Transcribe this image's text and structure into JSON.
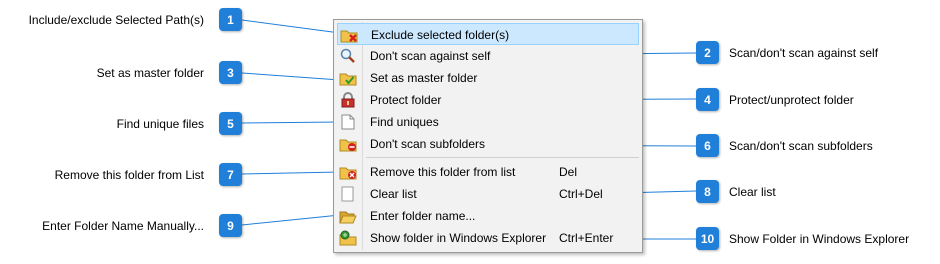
{
  "menu": {
    "items": [
      {
        "label": "Exclude selected folder(s)",
        "shortcut": "",
        "icon": "exclude-folder-icon"
      },
      {
        "label": "Don't scan against self",
        "shortcut": "",
        "icon": "magnifier-icon"
      },
      {
        "label": "Set as master folder",
        "shortcut": "",
        "icon": "master-folder-icon"
      },
      {
        "label": "Protect folder",
        "shortcut": "",
        "icon": "lock-icon"
      },
      {
        "label": "Find uniques",
        "shortcut": "",
        "icon": "blank-page-icon"
      },
      {
        "label": "Don't scan subfolders",
        "shortcut": "",
        "icon": "no-subfolders-icon"
      },
      {
        "label": "Remove this folder from list",
        "shortcut": "Del",
        "icon": "remove-folder-icon"
      },
      {
        "label": "Clear list",
        "shortcut": "Ctrl+Del",
        "icon": "empty-box-icon"
      },
      {
        "label": "Enter folder name...",
        "shortcut": "",
        "icon": "open-folder-icon"
      },
      {
        "label": "Show folder in Windows Explorer",
        "shortcut": "Ctrl+Enter",
        "icon": "explorer-icon"
      }
    ]
  },
  "callouts": [
    {
      "number": "1",
      "label": "Include/exclude Selected Path(s)"
    },
    {
      "number": "2",
      "label": "Scan/don't scan against self"
    },
    {
      "number": "3",
      "label": "Set as master folder"
    },
    {
      "number": "4",
      "label": "Protect/unprotect folder"
    },
    {
      "number": "5",
      "label": "Find unique files"
    },
    {
      "number": "6",
      "label": "Scan/don't scan subfolders"
    },
    {
      "number": "7",
      "label": "Remove this folder from List"
    },
    {
      "number": "8",
      "label": "Clear list"
    },
    {
      "number": "9",
      "label": "Enter Folder Name Manually..."
    },
    {
      "number": "10",
      "label": "Show Folder in Windows Explorer"
    }
  ],
  "colors": {
    "badge": "#1f7fd9",
    "highlight": "#cce8ff",
    "connector": "#1f7fd9"
  }
}
